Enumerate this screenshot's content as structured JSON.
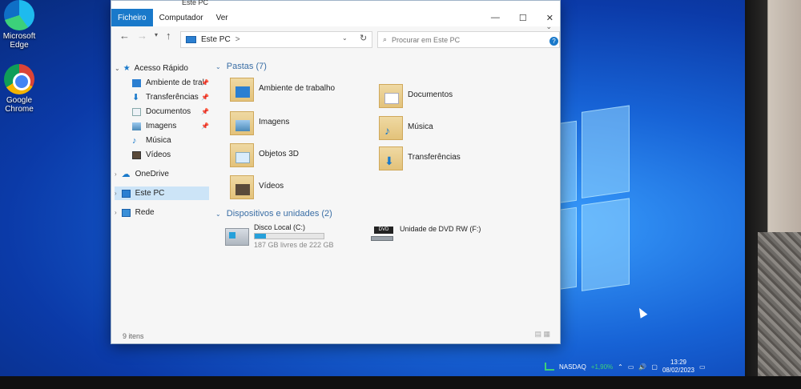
{
  "desktop": {
    "icons": [
      {
        "label_line1": "Microsoft",
        "label_line2": "Edge"
      },
      {
        "label_line1": "Google",
        "label_line2": "Chrome"
      }
    ]
  },
  "window": {
    "title": "Este PC",
    "ribbon_tabs": [
      "Ficheiro",
      "Computador",
      "Ver"
    ],
    "address": {
      "path": "Este PC",
      "separator": ">"
    },
    "search_placeholder": "Procurar em Este PC",
    "status": "9 itens"
  },
  "nav": {
    "items": [
      {
        "label": "Acesso Rápido",
        "icon": "star-icon"
      },
      {
        "label": "Ambiente de tral",
        "icon": "desktop-icon",
        "pinned": true
      },
      {
        "label": "Transferências",
        "icon": "download-icon",
        "pinned": true
      },
      {
        "label": "Documentos",
        "icon": "document-icon",
        "pinned": true
      },
      {
        "label": "Imagens",
        "icon": "image-icon",
        "pinned": true
      },
      {
        "label": "Música",
        "icon": "music-icon"
      },
      {
        "label": "Vídeos",
        "icon": "video-icon"
      },
      {
        "label": "OneDrive",
        "icon": "cloud-icon"
      },
      {
        "label": "Este PC",
        "icon": "pc-icon",
        "selected": true
      },
      {
        "label": "Rede",
        "icon": "network-icon"
      }
    ]
  },
  "content": {
    "folders_header": "Pastas (7)",
    "folders": [
      {
        "label": "Ambiente de trabalho",
        "icon": "desktop-folder-icon"
      },
      {
        "label": "Documentos",
        "icon": "documents-folder-icon"
      },
      {
        "label": "Imagens",
        "icon": "pictures-folder-icon"
      },
      {
        "label": "Música",
        "icon": "music-folder-icon"
      },
      {
        "label": "Objetos 3D",
        "icon": "3d-objects-folder-icon"
      },
      {
        "label": "Transferências",
        "icon": "downloads-folder-icon"
      },
      {
        "label": "Vídeos",
        "icon": "videos-folder-icon"
      }
    ],
    "devices_header": "Dispositivos e unidades (2)",
    "drives": [
      {
        "label": "Disco Local (C:)",
        "free_text": "187 GB livres de 222 GB",
        "used_fraction": 0.16
      },
      {
        "label": "Unidade de DVD RW (F:)",
        "badge": "DVD"
      }
    ]
  },
  "taskbar": {
    "ticker": "NASDAQ",
    "ticker_change": "+1,90%",
    "time": "13:29",
    "date": "08/02/2023"
  },
  "colors": {
    "accent": "#1979ca",
    "group_header": "#3a6ea5",
    "selection": "#cce4f7"
  }
}
